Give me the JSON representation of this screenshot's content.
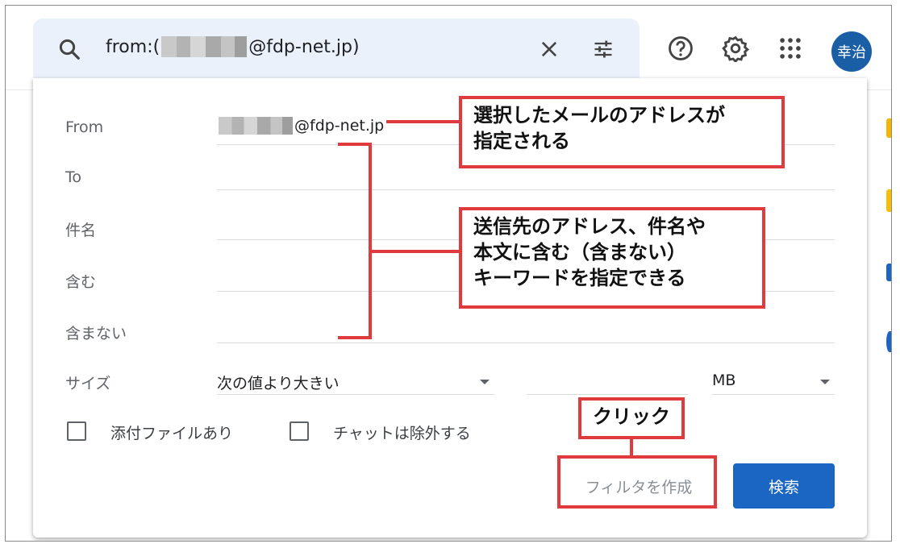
{
  "search": {
    "query_prefix": "from:(",
    "query_suffix": "@fdp-net.jp)"
  },
  "header": {
    "avatar_text": "幸治",
    "icons": [
      "search-icon",
      "close-icon",
      "tune-icon",
      "help-icon",
      "settings-icon",
      "apps-icon"
    ]
  },
  "form": {
    "from_label": "From",
    "from_value_suffix": "@fdp-net.jp",
    "to_label": "To",
    "subject_label": "件名",
    "has_words_label": "含む",
    "doesnt_have_label": "含まない",
    "size_label": "サイズ",
    "size_operator": "次の値より大きい",
    "size_unit": "MB",
    "has_attachment_label": "添付ファイルあり",
    "exclude_chats_label": "チャットは除外する",
    "create_filter_label": "フィルタを作成",
    "search_button_label": "検索"
  },
  "annotations": {
    "callout1_line1": "選択したメールのアドレスが",
    "callout1_line2": "指定される",
    "callout2_line1": "送信先のアドレス、件名や",
    "callout2_line2": "本文に含む（含まない）",
    "callout2_line3": "キーワードを指定できる",
    "callout3": "クリック"
  },
  "colors": {
    "annotation_red": "#e0393e",
    "primary_blue": "#1a66c2",
    "searchbar_bg": "#eaf1fb",
    "avatar_bg": "#1a5fa6"
  }
}
